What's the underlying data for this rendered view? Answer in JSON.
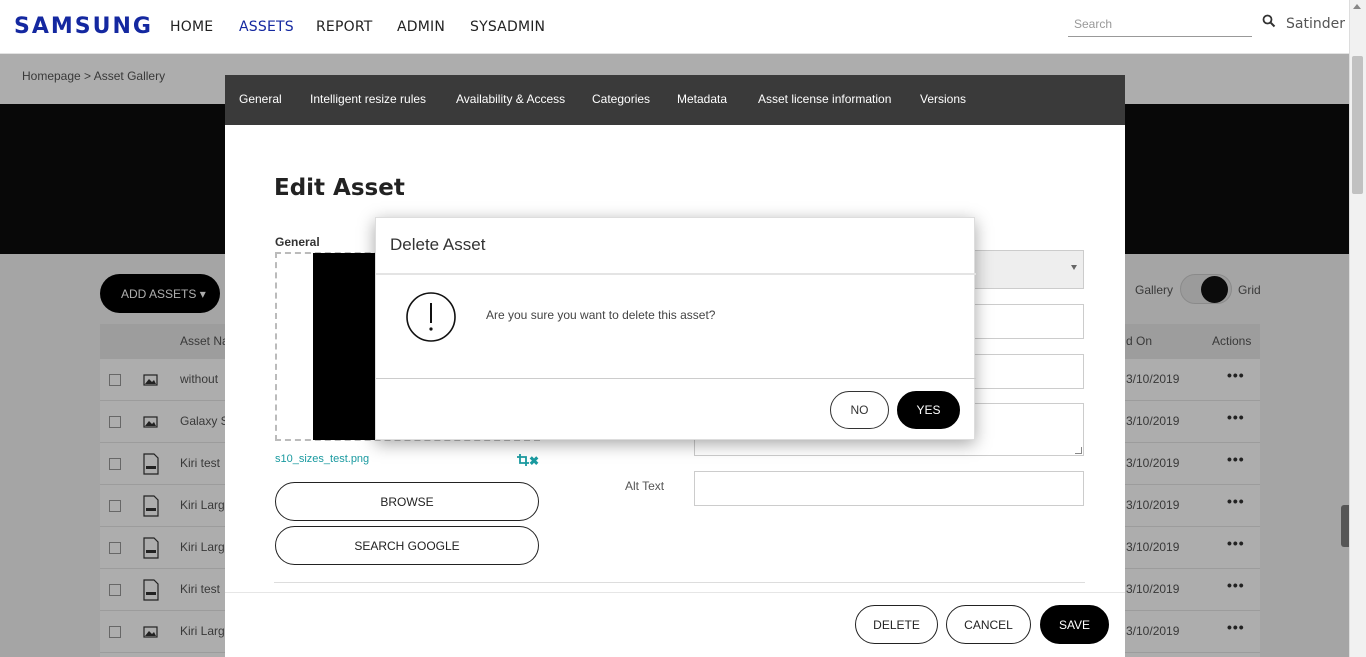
{
  "brand": {
    "logo": "SAMSUNG",
    "color": "#1428a0"
  },
  "nav": {
    "items": [
      "HOME",
      "ASSETS",
      "REPORT",
      "ADMIN",
      "SYSADMIN"
    ],
    "active": "ASSETS",
    "search_placeholder": "Search",
    "user": "Satinder"
  },
  "breadcrumb": "Homepage > Asset Gallery",
  "gallery": {
    "add_assets_label": "ADD ASSETS",
    "view_gallery": "Gallery",
    "view_grid": "Grid",
    "columns": {
      "asset_name": "Asset Na",
      "modified_on": "d On",
      "actions": "Actions"
    },
    "rows": [
      {
        "icon": "image-icon",
        "name": "without",
        "date": "3/10/2019"
      },
      {
        "icon": "image-icon",
        "name": "Galaxy S",
        "date": "3/10/2019"
      },
      {
        "icon": "doc-file-icon",
        "name": "Kiri test",
        "date": "3/10/2019"
      },
      {
        "icon": "pdf-file-icon",
        "name": "Kiri Larg",
        "date": "3/10/2019"
      },
      {
        "icon": "ppt-file-icon",
        "name": "Kiri Larg",
        "date": "3/10/2019"
      },
      {
        "icon": "ppt-file-icon",
        "name": "Kiri test",
        "date": "3/10/2019"
      },
      {
        "icon": "image-icon",
        "name": "Kiri Larg",
        "date": "3/10/2019"
      }
    ],
    "actions_glyph": "•••"
  },
  "edit_modal": {
    "tabs": [
      "General",
      "Intelligent resize rules",
      "Availability & Access",
      "Categories",
      "Metadata",
      "Asset license information",
      "Versions"
    ],
    "title": "Edit Asset",
    "section_label": "General",
    "file_name": "s10_sizes_test.png",
    "browse_label": "BROWSE",
    "search_google_label": "SEARCH GOOGLE",
    "alt_text_label": "Alt Text",
    "delete_label": "DELETE",
    "cancel_label": "CANCEL",
    "save_label": "SAVE",
    "accent": "#1a9aa0"
  },
  "delete_dialog": {
    "title": "Delete Asset",
    "message": "Are you sure you want to delete this asset?",
    "no_label": "NO",
    "yes_label": "YES"
  }
}
